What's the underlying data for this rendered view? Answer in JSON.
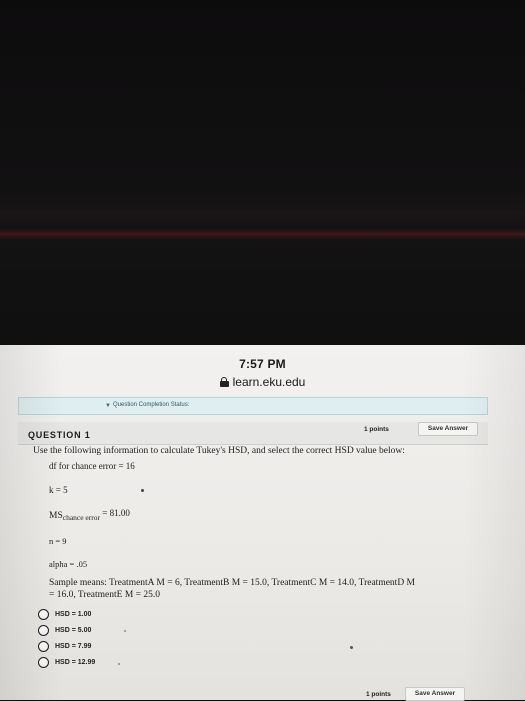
{
  "status_bar": {
    "time": "7:57 PM",
    "url": "learn.eku.edu"
  },
  "completion": {
    "label": "Question Completion Status:"
  },
  "question": {
    "title": "QUESTION 1",
    "points": "1 points",
    "save_label": "Save Answer",
    "instruction": "Use the following information to calculate Tukey's HSD, and select the correct HSD value below:",
    "df_line": "df for chance error = 16",
    "k_line": "k = 5",
    "ms_prefix": "MS",
    "ms_sub": "chance error",
    "ms_value": " = 81.00",
    "n_line": "n = 9",
    "alpha_line": "alpha = .05",
    "means_line1": "Sample means: TreatmentA M = 6, TreatmentB M = 15.0, TreatmentC M = 14.0, TreatmentD M",
    "means_line2": "= 16.0, TreatmentE M = 25.0"
  },
  "options": [
    {
      "label": "HSD = 1.00"
    },
    {
      "label": "HSD = 5.00"
    },
    {
      "label": "HSD = 7.99"
    },
    {
      "label": "HSD = 12.99"
    }
  ],
  "footer": {
    "points": "1 points",
    "save_label": "Save Answer"
  }
}
